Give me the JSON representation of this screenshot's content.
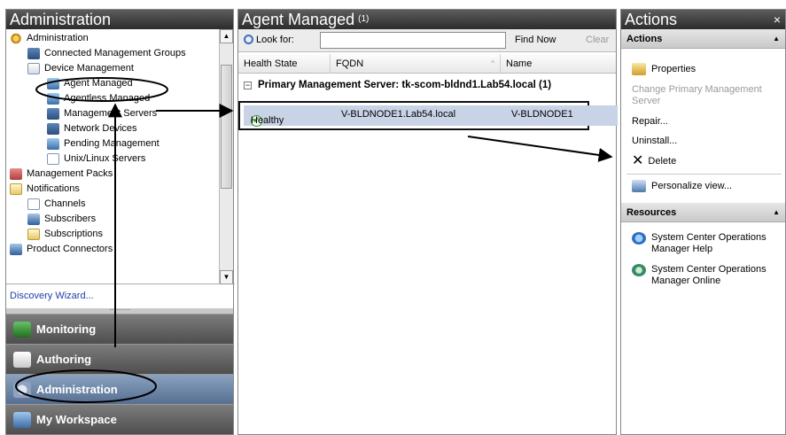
{
  "left": {
    "title": "Administration",
    "tree": [
      {
        "label": "Administration",
        "icon": "gear-icon"
      },
      {
        "label": "Connected Management Groups",
        "icon": "computers-icon"
      },
      {
        "label": "Device Management",
        "icon": "folder-icon"
      },
      {
        "label": "Agent Managed",
        "icon": "agent-icon"
      },
      {
        "label": "Agentless Managed",
        "icon": "agentless-icon"
      },
      {
        "label": "Management Servers",
        "icon": "server-icon"
      },
      {
        "label": "Network Devices",
        "icon": "network-icon"
      },
      {
        "label": "Pending Management",
        "icon": "pending-icon"
      },
      {
        "label": "Unix/Linux Servers",
        "icon": "unix-icon"
      },
      {
        "label": "Management Packs",
        "icon": "pack-icon"
      },
      {
        "label": "Notifications",
        "icon": "mail-icon"
      },
      {
        "label": "Channels",
        "icon": "channel-icon"
      },
      {
        "label": "Subscribers",
        "icon": "subscriber-icon"
      },
      {
        "label": "Subscriptions",
        "icon": "subscription-icon"
      },
      {
        "label": "Product Connectors",
        "icon": "connector-icon"
      }
    ],
    "wizard_link": "Discovery Wizard...",
    "wunderbar": [
      {
        "label": "Monitoring"
      },
      {
        "label": "Authoring"
      },
      {
        "label": "Administration"
      },
      {
        "label": "My Workspace"
      }
    ]
  },
  "middle": {
    "title": "Agent Managed",
    "count": "(1)",
    "search": {
      "label": "Look for:",
      "value": "",
      "find": "Find Now",
      "clear": "Clear"
    },
    "columns": [
      "Health State",
      "FQDN",
      "Name"
    ],
    "group": "Primary Management Server: tk-scom-bldnd1.Lab54.local (1)",
    "rows": [
      {
        "health": "Healthy",
        "fqdn": "V-BLDNODE1.Lab54.local",
        "name": "V-BLDNODE1"
      }
    ]
  },
  "right": {
    "title": "Actions",
    "close": "×",
    "actions_header": "Actions",
    "actions": [
      {
        "label": "Properties",
        "enabled": true
      },
      {
        "label": "Change Primary Management Server",
        "enabled": false
      },
      {
        "label": "Repair...",
        "enabled": true
      },
      {
        "label": "Uninstall...",
        "enabled": true
      },
      {
        "label": "Delete",
        "enabled": true
      },
      {
        "label": "Personalize view...",
        "enabled": true
      }
    ],
    "resources_header": "Resources",
    "resources": [
      {
        "label": "System Center Operations Manager Help"
      },
      {
        "label": "System Center Operations Manager Online"
      }
    ]
  },
  "colors": {
    "header_dark": "#3a3a3a",
    "selected_row": "#c9d3e6",
    "link": "#1d3fa7"
  }
}
